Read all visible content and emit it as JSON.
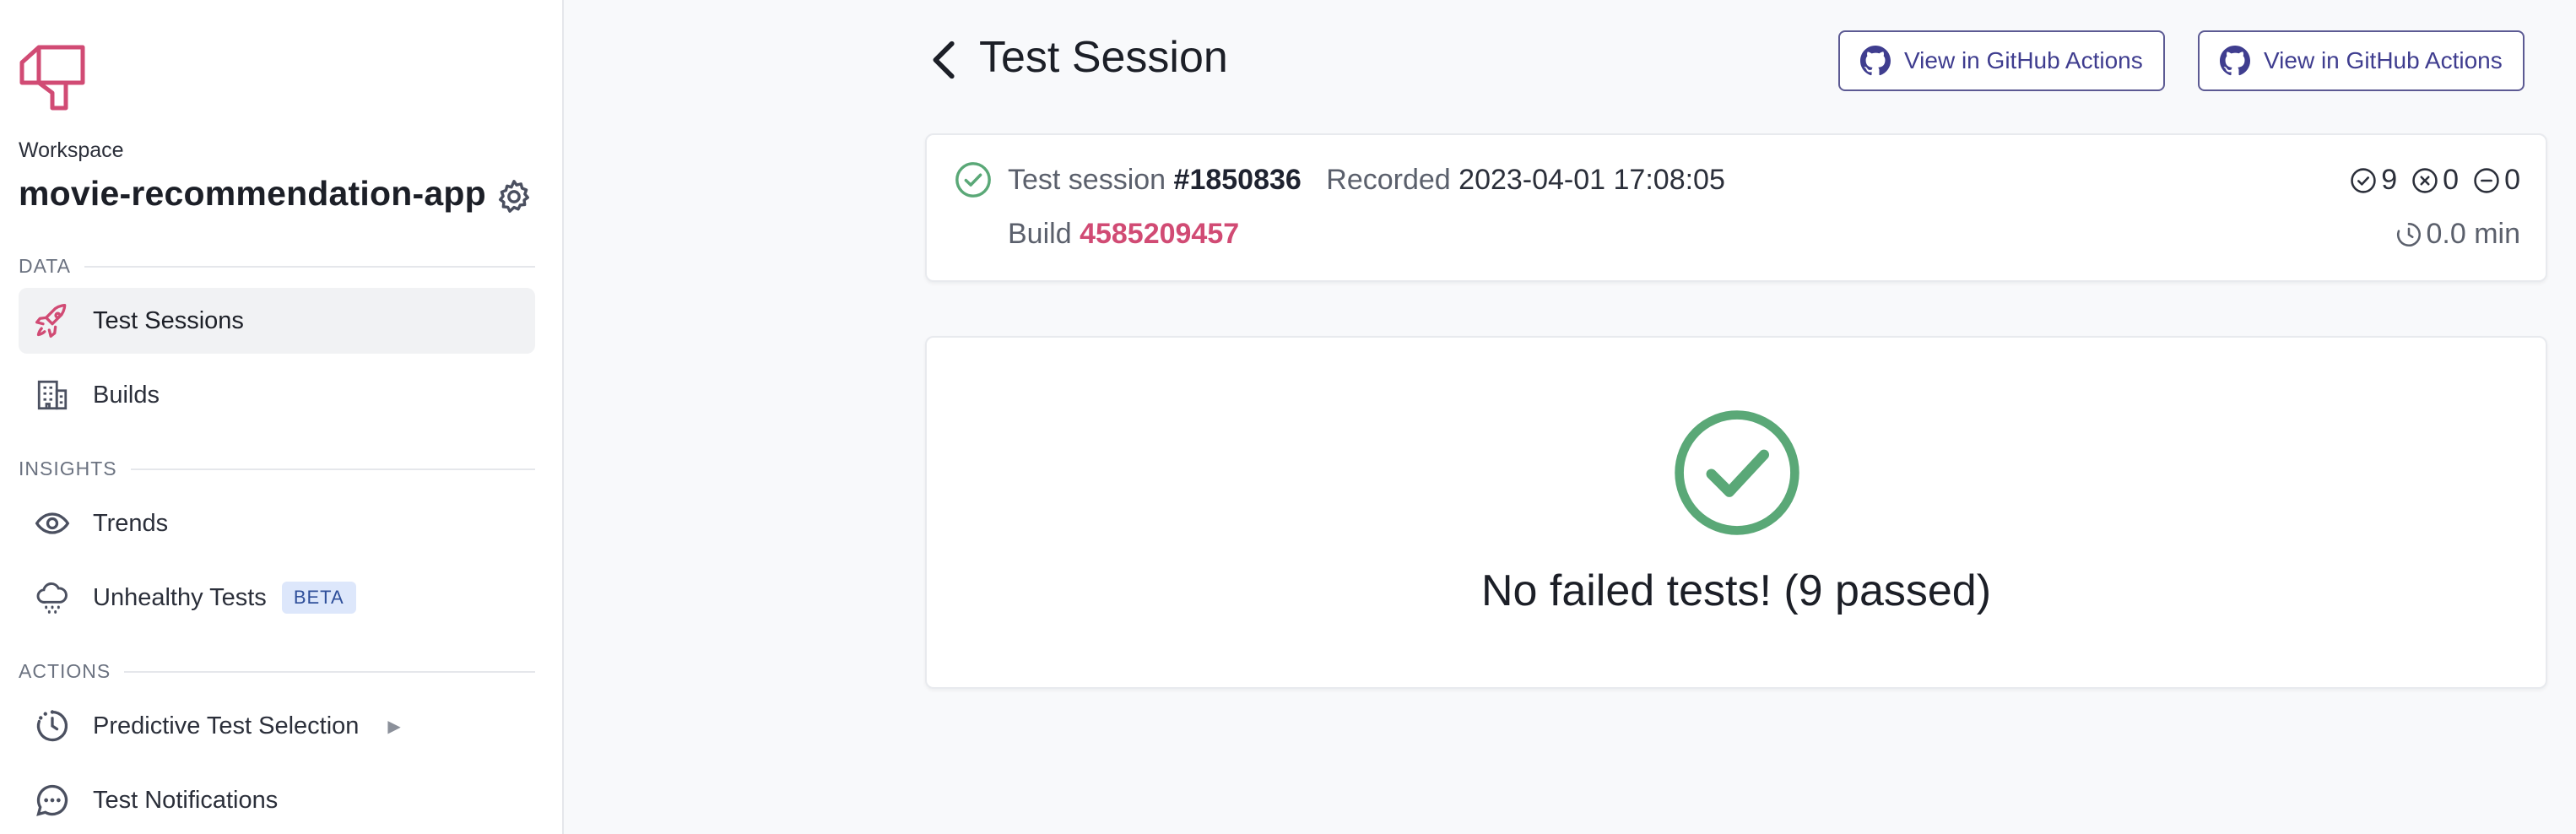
{
  "sidebar": {
    "workspace_label": "Workspace",
    "workspace_name": "movie-recommendation-app",
    "sections": {
      "data": "DATA",
      "insights": "INSIGHTS",
      "actions": "ACTIONS"
    },
    "items": [
      {
        "label": "Test Sessions",
        "icon": "rocket-icon",
        "active": true
      },
      {
        "label": "Builds",
        "icon": "building-icon"
      },
      {
        "label": "Trends",
        "icon": "eye-icon"
      },
      {
        "label": "Unhealthy Tests",
        "icon": "cloud-rain-icon",
        "badge": "BETA"
      },
      {
        "label": "Predictive Test Selection",
        "icon": "clock-icon",
        "caret": "▶"
      },
      {
        "label": "Test Notifications",
        "icon": "chat-bubble-icon"
      }
    ]
  },
  "header": {
    "title": "Test Session",
    "buttons": [
      "View in GitHub Actions",
      "View in GitHub Actions"
    ]
  },
  "session": {
    "label": "Test session",
    "id": "#1850836",
    "recorded_label": "Recorded",
    "recorded_at": "2023-04-01 17:08:05",
    "build_label": "Build",
    "build_number": "4585209457",
    "passed": "9",
    "failed": "0",
    "skipped": "0",
    "duration": "0.0 min"
  },
  "result": {
    "message": "No failed tests! (9 passed)"
  },
  "colors": {
    "accent": "#d14b74",
    "success": "#5aa877",
    "button_border": "#5c5a93"
  }
}
